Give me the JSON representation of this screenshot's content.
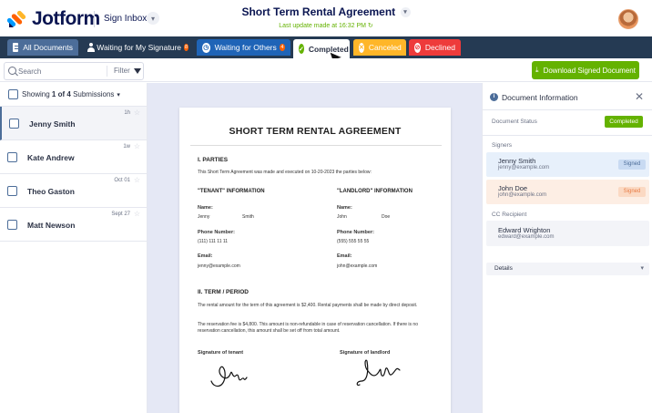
{
  "header": {
    "logo_text": "Jotform",
    "product": "Sign Inbox",
    "doc_title": "Short Term Rental Agreement",
    "last_update": "Last update made at 16:32 PM"
  },
  "tabs": [
    {
      "label": "All Documents"
    },
    {
      "label": "Waiting for My Signature",
      "count": "8"
    },
    {
      "label": "Waiting for Others",
      "count": "4"
    },
    {
      "label": "Completed"
    },
    {
      "label": "Canceled"
    },
    {
      "label": "Declined"
    }
  ],
  "toolbar": {
    "search_placeholder": "Search",
    "filter_label": "Filter",
    "download_label": "Download Signed Document"
  },
  "list": {
    "showing_prefix": "Showing",
    "showing_range": "1 of 4",
    "showing_suffix": "Submissions",
    "rows": [
      {
        "name": "Jenny Smith",
        "date": "1h"
      },
      {
        "name": "Kate Andrew",
        "date": "1w"
      },
      {
        "name": "Theo Gaston",
        "date": "Oct 01"
      },
      {
        "name": "Matt Newson",
        "date": "Sept 27"
      }
    ]
  },
  "document": {
    "title": "SHORT TERM RENTAL AGREEMENT",
    "parties_heading": "I. PARTIES",
    "parties_text": "This Short Term Agreement was made and executed on 10-20-2023 the parties below:",
    "tenant_heading": "\"TENANT\" INFORMATION",
    "landlord_heading": "\"LANDLORD\" INFORMATION",
    "name_label": "Name:",
    "phone_label": "Phone Number:",
    "email_label": "Email:",
    "tenant_first": "Jenny",
    "tenant_last": "Smith",
    "tenant_phone": "(111) 111 11 11",
    "tenant_email": "jenny@example.com",
    "landlord_first": "John",
    "landlord_last": "Doe",
    "landlord_phone": "(555) 555 55 55",
    "landlord_email": "john@example.com",
    "term_heading": "II. TERM / PERIOD",
    "term_text1": "The rental amount for the term of this agreement is $2,400. Rental payments shall be made by direct deposit.",
    "term_text2": "The reservation fee is $4,800. This amount is non-refundable in case of reservation cancellation. If there is no reservation cancellation, this amount shall be set off from total amount.",
    "sig_tenant_label": "Signature of tenant",
    "sig_landlord_label": "Signature of landlord"
  },
  "panel": {
    "title": "Document Information",
    "status_label": "Document Status",
    "status_value": "Completed",
    "signers_label": "Signers",
    "signers": [
      {
        "name": "Jenny Smith",
        "email": "jenny@example.com",
        "status": "Signed"
      },
      {
        "name": "John Doe",
        "email": "john@example.com",
        "status": "Signed"
      }
    ],
    "cc_label": "CC Recipient",
    "cc_name": "Edward Wrighton",
    "cc_email": "edward@example.com",
    "details_label": "Details"
  },
  "colors": {
    "nav_bg": "#253a53",
    "accent_green": "#64b200",
    "canceled": "#ffb629",
    "declined": "#ee3b3b",
    "waiting_others": "#1f64b7",
    "all_docs": "#4c6d99"
  }
}
